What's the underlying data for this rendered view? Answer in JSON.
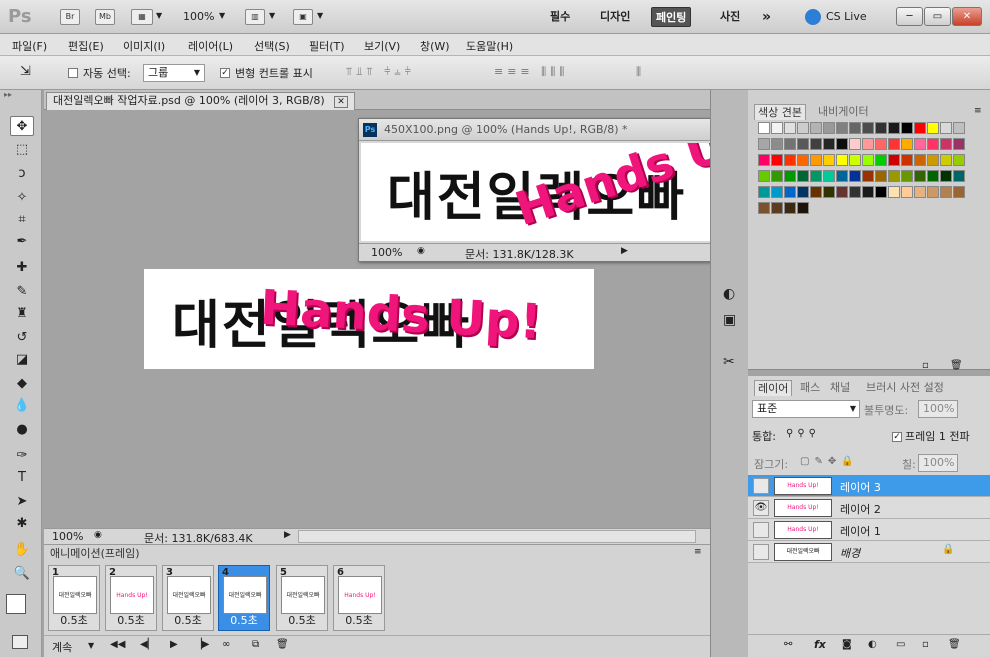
{
  "appbar": {
    "logo": "Ps",
    "bridge": "Br",
    "minibridge": "Mb",
    "zoom": "100%",
    "workspaces": [
      "필수",
      "디자인",
      "페인팅",
      "사진"
    ],
    "more": "»",
    "cslive": "CS Live",
    "minimize": "─",
    "restore": "▭",
    "close": "✕"
  },
  "menu": [
    "파일(F)",
    "편집(E)",
    "이미지(I)",
    "레이어(L)",
    "선택(S)",
    "필터(T)",
    "보기(V)",
    "창(W)",
    "도움말(H)"
  ],
  "options": {
    "auto_select_label": "자동 선택:",
    "auto_select_value": "그룹",
    "transform_label": "변형 컨트롤 표시"
  },
  "document": {
    "tab_title": "대전일렉오빠 작업자료.psd @ 100% (레이어 3, RGB/8)",
    "zoom": "100%",
    "file_info": "문서: 131.8K/683.4K",
    "bg_text": "대전일렉오빠",
    "logo_text": "Hands Up!"
  },
  "floatwin": {
    "title": "450X100.png @ 100% (Hands Up!, RGB/8) *",
    "zoom": "100%",
    "file_info": "문서: 131.8K/128.3K",
    "bg_text": "대전일렉오빠",
    "logo_text": "Hands Up"
  },
  "animation": {
    "title": "애니메이션(프레임)",
    "loop": "계속",
    "frames": [
      {
        "num": "1",
        "delay": "0.5초",
        "thumb": "대전일렉오빠"
      },
      {
        "num": "2",
        "delay": "0.5초",
        "thumb": "Hands Up!"
      },
      {
        "num": "3",
        "delay": "0.5초",
        "thumb": "대전일렉오빠"
      },
      {
        "num": "4",
        "delay": "0.5초",
        "thumb": "대전일렉오빠"
      },
      {
        "num": "5",
        "delay": "0.5초",
        "thumb": "대전일렉오빠"
      },
      {
        "num": "6",
        "delay": "0.5초",
        "thumb": "Hands Up!"
      }
    ]
  },
  "swatches": {
    "tabs": [
      "색상 견본",
      "내비게이터"
    ],
    "colors": [
      "#ffffff",
      "#f2f2f2",
      "#e0e0e0",
      "#cccccc",
      "#b3b3b3",
      "#999999",
      "#808080",
      "#666666",
      "#4d4d4d",
      "#333333",
      "#1a1a1a",
      "#000000",
      "#ff0000",
      "#ffff00",
      "#d9d9d9",
      "#bfbfbf",
      "#a6a6a6",
      "#8c8c8c",
      "#737373",
      "#595959",
      "#404040",
      "#262626",
      "#0d0d0d",
      "#ffcccc",
      "#ff9999",
      "#ff6666",
      "#ff3333",
      "#ffaa00",
      "#ff6699",
      "#ff3366",
      "#cc3366",
      "#993366",
      "#ff0066",
      "#ff0000",
      "#ff3300",
      "#ff6600",
      "#ff9900",
      "#ffcc00",
      "#ffff00",
      "#ccff00",
      "#99ff00",
      "#00cc00",
      "#cc0000",
      "#cc3300",
      "#cc6600",
      "#cc9900",
      "#cccc00",
      "#99cc00",
      "#66cc00",
      "#339900",
      "#009900",
      "#006633",
      "#009966",
      "#00cc99",
      "#006699",
      "#003399",
      "#993300",
      "#996600",
      "#999900",
      "#669900",
      "#336600",
      "#006600",
      "#003300",
      "#006666",
      "#009999",
      "#0099cc",
      "#0066cc",
      "#003366",
      "#663300",
      "#333300",
      "#663333",
      "#333333",
      "#1a1a1a",
      "#000000",
      "#ffe0b3",
      "#ffcc99",
      "#e6b380",
      "#cc9966",
      "#b38050",
      "#996633",
      "#7a5230",
      "#5c3d20",
      "#3d2810",
      "#1f140a"
    ]
  },
  "layers": {
    "tabs": [
      "레이어",
      "패스",
      "채널",
      "브러시 사전 설정"
    ],
    "blend_mode": "표준",
    "opacity_label": "불투명도:",
    "opacity": "100%",
    "unify_label": "통합:",
    "propagate_label": "프레임 1 전파",
    "lock_label": "잠그기:",
    "fill_label": "칠:",
    "fill": "100%",
    "items": [
      {
        "name": "레이어 3",
        "thumb": "Hands Up!",
        "visible": ""
      },
      {
        "name": "레이어 2",
        "thumb": "Hands Up!",
        "visible": "👁"
      },
      {
        "name": "레이어 1",
        "thumb": "Hands Up!",
        "visible": ""
      },
      {
        "name": "배경",
        "thumb": "대전일렉오빠",
        "visible": ""
      }
    ]
  },
  "colors": {
    "accent": "#3d9be9",
    "logo_pink": "#f0157a"
  }
}
